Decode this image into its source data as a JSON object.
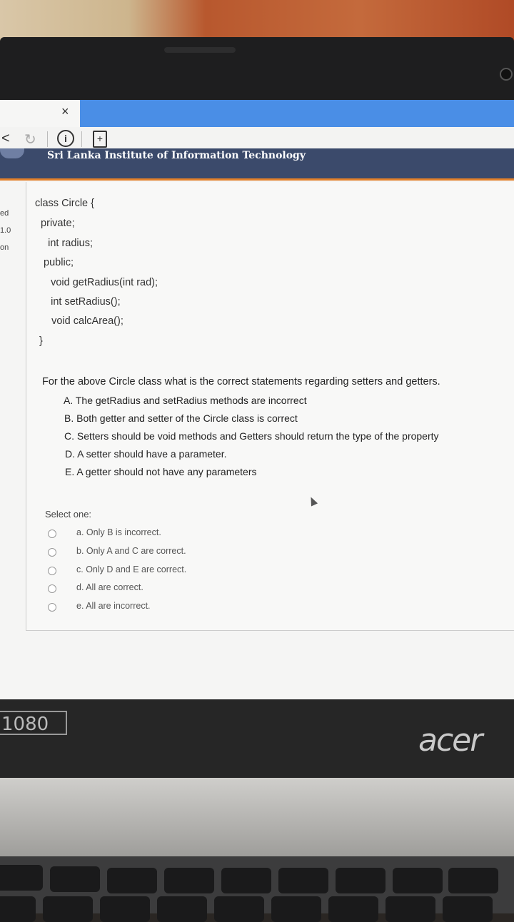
{
  "browser": {
    "tab_close": "×",
    "back": "<",
    "reload": "↻"
  },
  "banner": {
    "title": "Sri Lanka Institute of Information Technology"
  },
  "sidebar": [
    "ed",
    "1.0",
    "on"
  ],
  "code_lines": [
    "class Circle {",
    "  private;",
    "    int radius;",
    "  public;",
    "    void getRadius(int rad);",
    "    int setRadius();",
    "    void calcArea();",
    "}"
  ],
  "question": {
    "text": "For the above Circle class what is the correct statements regarding setters and getters.",
    "statements": [
      "A. The getRadius and setRadius methods are incorrect",
      "B. Both getter and setter of the Circle class is correct",
      "C. Setters should be void methods and Getters should return the type of the property",
      "D. A setter should have a parameter.",
      "E.  A getter should not have any parameters"
    ],
    "select_label": "Select one:",
    "options": [
      "a. Only B is incorrect.",
      "b. Only A and C are correct.",
      "c. Only D and E are correct.",
      "d. All are correct.",
      "e. All are incorrect."
    ]
  },
  "laptop": {
    "resolution_badge": "1080",
    "brand": "acer"
  }
}
